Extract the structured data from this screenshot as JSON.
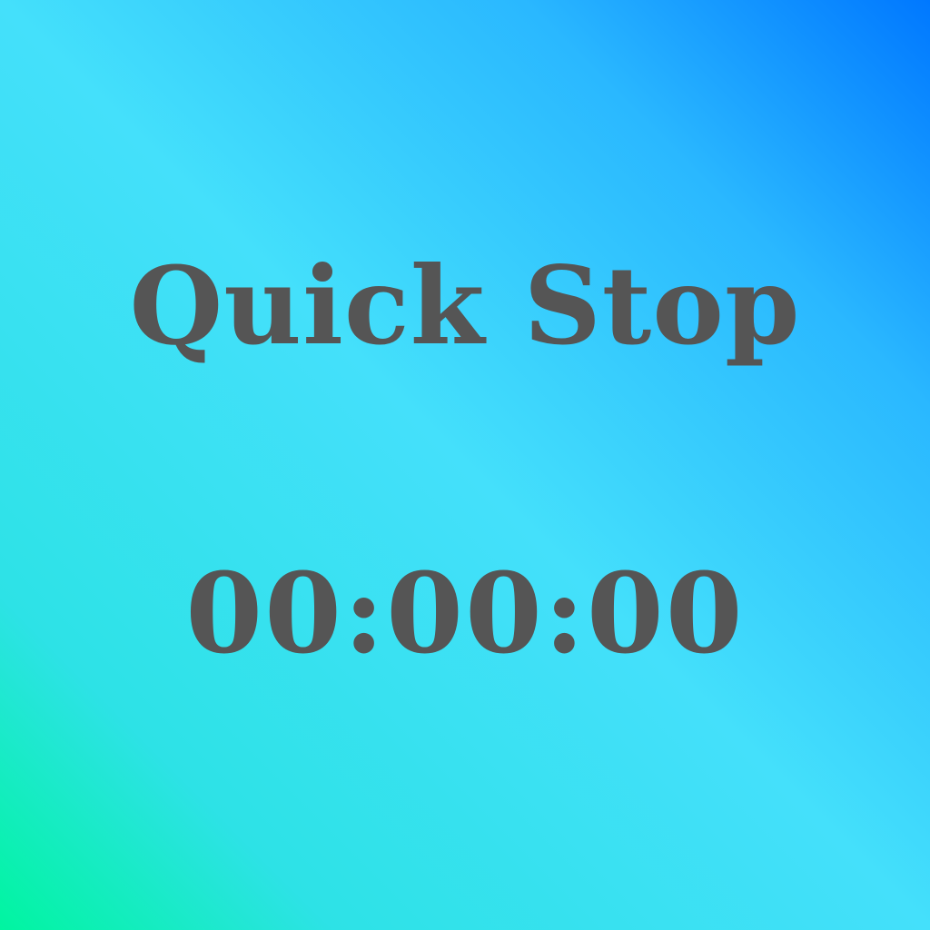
{
  "app": {
    "title": "Quick Stop"
  },
  "timer": {
    "display": "00:00:00"
  },
  "colors": {
    "text": "#555555",
    "gradient_start": "#00f5a0",
    "gradient_mid": "#44e0fb",
    "gradient_end": "#0078ff"
  }
}
